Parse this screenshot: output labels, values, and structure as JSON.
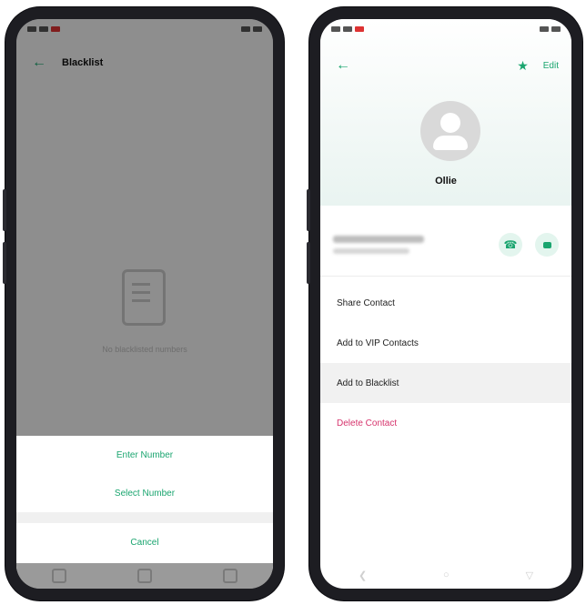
{
  "left_screen": {
    "header": {
      "title": "Blacklist"
    },
    "empty_state": {
      "text": "No blacklisted numbers"
    },
    "action_sheet": {
      "options": [
        "Enter Number",
        "Select Number"
      ],
      "cancel": "Cancel"
    }
  },
  "right_screen": {
    "contact": {
      "name": "Ollie"
    },
    "actions": {
      "edit": "Edit"
    },
    "menu": [
      "Share Contact",
      "Add to VIP Contacts",
      "Add to Blacklist",
      "Delete Contact"
    ]
  },
  "colors": {
    "accent": "#1aa56f",
    "danger": "#d6336c"
  },
  "icons": [
    "back-arrow-icon",
    "star-icon",
    "call-icon",
    "message-icon",
    "avatar-icon",
    "blacklist-empty-icon"
  ]
}
